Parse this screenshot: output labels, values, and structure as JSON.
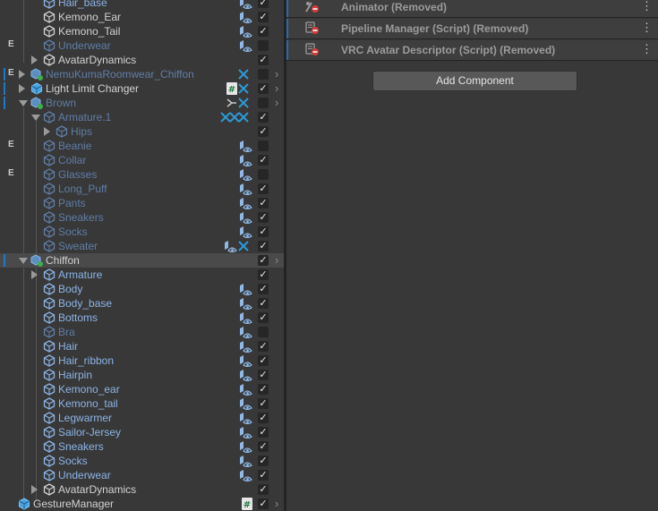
{
  "hierarchy": {
    "rows": [
      {
        "label": "Hair_base",
        "badge": "",
        "depth": 2,
        "fold": "",
        "style": "prefab",
        "icons": [
          "eye"
        ],
        "checked": true,
        "arrow": false
      },
      {
        "label": "Kemono_Ear",
        "badge": "",
        "depth": 2,
        "fold": "",
        "style": "normal",
        "icons": [
          "eye"
        ],
        "checked": true,
        "arrow": false
      },
      {
        "label": "Kemono_Tail",
        "badge": "",
        "depth": 2,
        "fold": "",
        "style": "normal",
        "icons": [
          "eye"
        ],
        "checked": true,
        "arrow": false
      },
      {
        "label": "Underwear",
        "badge": "E",
        "depth": 2,
        "fold": "",
        "style": "prefab-inactive",
        "icons": [
          "eye"
        ],
        "checked": false,
        "arrow": false
      },
      {
        "label": "AvatarDynamics",
        "badge": "",
        "depth": 2,
        "fold": "right",
        "style": "normal",
        "icons": [],
        "checked": true,
        "arrow": false
      },
      {
        "label": "NemuKumaRoomwear_Chiffon",
        "badge": "E",
        "depth": 1,
        "fold": "right",
        "style": "prefab-inactive",
        "icons": [
          "vrc"
        ],
        "checked": false,
        "arrow": true,
        "accent": true
      },
      {
        "label": "Light Limit Changer",
        "badge": "",
        "depth": 1,
        "fold": "right",
        "style": "normal",
        "icons": [
          "hash",
          "vrc"
        ],
        "checked": true,
        "arrow": true,
        "accent": true
      },
      {
        "label": "Brown",
        "badge": "",
        "depth": 1,
        "fold": "down",
        "style": "prefab-inactive",
        "icons": [
          "link",
          "vrc"
        ],
        "checked": false,
        "arrow": true,
        "accent": true
      },
      {
        "label": "Armature.1",
        "badge": "",
        "depth": 2,
        "fold": "down",
        "style": "prefab-inactive",
        "icons": [
          "vrc3"
        ],
        "checked": true,
        "arrow": false
      },
      {
        "label": "Hips",
        "badge": "",
        "depth": 3,
        "fold": "right",
        "style": "prefab-inactive",
        "icons": [],
        "checked": true,
        "arrow": false
      },
      {
        "label": "Beanie",
        "badge": "E",
        "depth": 2,
        "fold": "",
        "style": "prefab-inactive",
        "icons": [
          "eye"
        ],
        "checked": false,
        "arrow": false
      },
      {
        "label": "Collar",
        "badge": "",
        "depth": 2,
        "fold": "",
        "style": "prefab-inactive",
        "icons": [
          "eye"
        ],
        "checked": true,
        "arrow": false
      },
      {
        "label": "Glasses",
        "badge": "E",
        "depth": 2,
        "fold": "",
        "style": "prefab-inactive",
        "icons": [
          "eye"
        ],
        "checked": false,
        "arrow": false
      },
      {
        "label": "Long_Puff",
        "badge": "",
        "depth": 2,
        "fold": "",
        "style": "prefab-inactive",
        "icons": [
          "eye"
        ],
        "checked": true,
        "arrow": false
      },
      {
        "label": "Pants",
        "badge": "",
        "depth": 2,
        "fold": "",
        "style": "prefab-inactive",
        "icons": [
          "eye"
        ],
        "checked": true,
        "arrow": false
      },
      {
        "label": "Sneakers",
        "badge": "",
        "depth": 2,
        "fold": "",
        "style": "prefab-inactive",
        "icons": [
          "eye"
        ],
        "checked": true,
        "arrow": false
      },
      {
        "label": "Socks",
        "badge": "",
        "depth": 2,
        "fold": "",
        "style": "prefab-inactive",
        "icons": [
          "eye"
        ],
        "checked": true,
        "arrow": false
      },
      {
        "label": "Sweater",
        "badge": "",
        "depth": 2,
        "fold": "",
        "style": "prefab-inactive",
        "icons": [
          "eye",
          "vrc"
        ],
        "checked": true,
        "arrow": false
      },
      {
        "label": "Chiffon",
        "badge": "",
        "depth": 1,
        "fold": "down",
        "style": "normal",
        "icons": [],
        "checked": true,
        "arrow": true,
        "accent": true,
        "selected": true
      },
      {
        "label": "Armature",
        "badge": "",
        "depth": 2,
        "fold": "right",
        "style": "prefab",
        "icons": [],
        "checked": true,
        "arrow": false
      },
      {
        "label": "Body",
        "badge": "",
        "depth": 2,
        "fold": "",
        "style": "prefab",
        "icons": [
          "eye"
        ],
        "checked": true,
        "arrow": false
      },
      {
        "label": "Body_base",
        "badge": "",
        "depth": 2,
        "fold": "",
        "style": "prefab",
        "icons": [
          "eye"
        ],
        "checked": true,
        "arrow": false
      },
      {
        "label": "Bottoms",
        "badge": "",
        "depth": 2,
        "fold": "",
        "style": "prefab",
        "icons": [
          "eye"
        ],
        "checked": true,
        "arrow": false
      },
      {
        "label": "Bra",
        "badge": "",
        "depth": 2,
        "fold": "",
        "style": "prefab-inactive",
        "icons": [
          "eye"
        ],
        "checked": false,
        "arrow": false
      },
      {
        "label": "Hair",
        "badge": "",
        "depth": 2,
        "fold": "",
        "style": "prefab",
        "icons": [
          "eye"
        ],
        "checked": true,
        "arrow": false
      },
      {
        "label": "Hair_ribbon",
        "badge": "",
        "depth": 2,
        "fold": "",
        "style": "prefab",
        "icons": [
          "eye"
        ],
        "checked": true,
        "arrow": false
      },
      {
        "label": "Hairpin",
        "badge": "",
        "depth": 2,
        "fold": "",
        "style": "prefab",
        "icons": [
          "eye"
        ],
        "checked": true,
        "arrow": false
      },
      {
        "label": "Kemono_ear",
        "badge": "",
        "depth": 2,
        "fold": "",
        "style": "prefab",
        "icons": [
          "eye"
        ],
        "checked": true,
        "arrow": false
      },
      {
        "label": "Kemono_tail",
        "badge": "",
        "depth": 2,
        "fold": "",
        "style": "prefab",
        "icons": [
          "eye"
        ],
        "checked": true,
        "arrow": false
      },
      {
        "label": "Legwarmer",
        "badge": "",
        "depth": 2,
        "fold": "",
        "style": "prefab",
        "icons": [
          "eye"
        ],
        "checked": true,
        "arrow": false
      },
      {
        "label": "Sailor-Jersey",
        "badge": "",
        "depth": 2,
        "fold": "",
        "style": "prefab",
        "icons": [
          "eye"
        ],
        "checked": true,
        "arrow": false
      },
      {
        "label": "Sneakers",
        "badge": "",
        "depth": 2,
        "fold": "",
        "style": "prefab",
        "icons": [
          "eye"
        ],
        "checked": true,
        "arrow": false
      },
      {
        "label": "Socks",
        "badge": "",
        "depth": 2,
        "fold": "",
        "style": "prefab",
        "icons": [
          "eye"
        ],
        "checked": true,
        "arrow": false
      },
      {
        "label": "Underwear",
        "badge": "",
        "depth": 2,
        "fold": "",
        "style": "prefab",
        "icons": [
          "eye"
        ],
        "checked": true,
        "arrow": false
      },
      {
        "label": "AvatarDynamics",
        "badge": "",
        "depth": 2,
        "fold": "right",
        "style": "normal",
        "icons": [],
        "checked": true,
        "arrow": false
      },
      {
        "label": "GestureManager",
        "badge": "",
        "depth": 0,
        "fold": "",
        "style": "normal",
        "icons": [
          "hash"
        ],
        "checked": true,
        "arrow": true
      }
    ]
  },
  "inspector": {
    "components": [
      {
        "title": "Animator (Removed)",
        "icon": "animator-icon"
      },
      {
        "title": "Pipeline Manager (Script) (Removed)",
        "icon": "script-icon"
      },
      {
        "title": "VRC Avatar Descriptor (Script) (Removed)",
        "icon": "script-icon"
      }
    ],
    "add_component_label": "Add Component",
    "menu_glyph": "⋮"
  },
  "colors": {
    "background": "#383838",
    "selected_row": "#4a4a4a",
    "prefab_text": "#8cb4e6",
    "accent": "#1f77c8",
    "removed_badge": "#d23c3c"
  }
}
